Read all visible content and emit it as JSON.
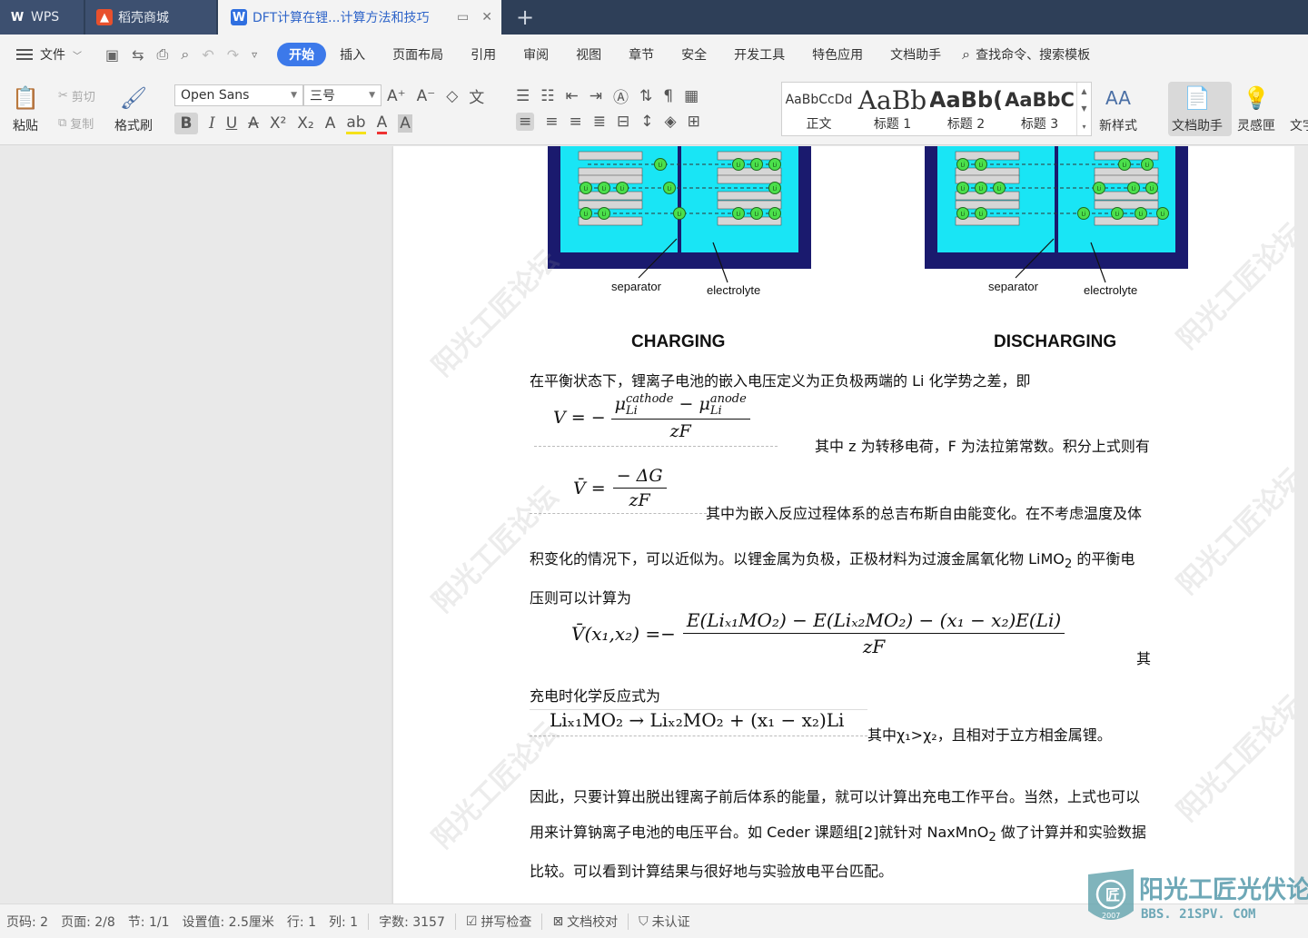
{
  "tabs": [
    {
      "label": "WPS",
      "icon": "wps-logo-icon"
    },
    {
      "label": "稻壳商城",
      "icon": "docer-icon"
    },
    {
      "label": "DFT计算在锂...计算方法和技巧",
      "icon": "word-doc-icon",
      "active": true
    }
  ],
  "menu": {
    "file_label": "文件",
    "tabs": [
      "开始",
      "插入",
      "页面布局",
      "引用",
      "审阅",
      "视图",
      "章节",
      "安全",
      "开发工具",
      "特色应用",
      "文档助手"
    ],
    "active_tab": "开始",
    "search_label": "查找命令、搜索模板"
  },
  "ribbon": {
    "paste": "粘贴",
    "cut": "剪切",
    "copy": "复制",
    "format_painter": "格式刷",
    "font_name": "Open Sans",
    "font_size": "三号",
    "styles": [
      {
        "sample": "AaBbCcDd",
        "label": "正文"
      },
      {
        "sample": "AaBb",
        "label": "标题 1"
      },
      {
        "sample": "AaBb(",
        "label": "标题 2"
      },
      {
        "sample": "AaBbC",
        "label": "标题 3"
      }
    ],
    "new_style": "新样式",
    "doc_assistant": "文档助手",
    "inspiration": "灵感匣",
    "text_tool": "文字"
  },
  "document": {
    "figure_labels": {
      "separator": "separator",
      "electrolyte": "electrolyte",
      "li": "Li"
    },
    "captions": {
      "charging": "CHARGING",
      "discharging": "DISCHARGING"
    },
    "para1": "在平衡状态下，锂离子电池的嵌入电压定义为正负极两端的 Li 化学势之差，即",
    "eq1": {
      "lhs": "V = −",
      "num_a": "μ",
      "num_a_sup": "cathode",
      "num_a_sub": "Li",
      "minus": " − ",
      "num_b": "μ",
      "num_b_sup": "anode",
      "num_b_sub": "Li",
      "den": "zF"
    },
    "para2": "其中 z 为转移电荷，F 为法拉第常数。积分上式则有",
    "eq2": {
      "lhs": "V̄ =",
      "num": "− ΔG",
      "den": "zF"
    },
    "para3a": "其中为嵌入反应过程体系的总吉布斯自由能变化。在不考虑温度及体",
    "para3b_pre": "积变化的情况下，可以近似为。以锂金属为负极，正极材料为过渡金属氧化物 LiMO",
    "para3b_sub": "2",
    "para3b_post": " 的平衡电",
    "para3c": "压则可以计算为",
    "eq3": {
      "lhs": "V̄(x₁,x₂) =−",
      "num": "E(Liₓ₁MO₂) − E(Liₓ₂MO₂) − (x₁ − x₂)E(Li)",
      "den": "zF"
    },
    "para4_tail": "其",
    "para5": "充电时化学反应式为",
    "eq4": "Liₓ₁MO₂ → Liₓ₂MO₂ + (x₁ − x₂)Li",
    "para6": "其中χ₁>χ₂，且相对于立方相金属锂。",
    "para7a": "因此，只要计算出脱出锂离子前后体系的能量，就可以计算出充电工作平台。当然，上式也可以",
    "para7b_pre": "用来计算钠离子电池的电压平台。如 Ceder 课题组[2]就针对 NaxMnO",
    "para7b_sub": "2",
    "para7b_post": " 做了计算并和实验数据",
    "para7c": "比较。可以看到计算结果与很好地与实验放电平台匹配。"
  },
  "watermark": {
    "main": "阳光工匠论坛",
    "sub": "BBS. 21SPV. COM",
    "logo_main": "阳光工匠光伏论坛",
    "logo_sub": "BBS. 21SPV. COM",
    "logo_year": "2007"
  },
  "status": {
    "page_no": "页码: 2",
    "pages": "页面: 2/8",
    "section": "节: 1/1",
    "setting": "设置值: 2.5厘米",
    "row": "行: 1",
    "col": "列: 1",
    "words": "字数: 3157",
    "spell_check": "拼写检查",
    "doc_proof": "文档校对",
    "uncertified": "未认证"
  },
  "colors": {
    "accent": "#3c79ea",
    "tabbar": "#2e3f58",
    "battery_blue": "#1a1a6e",
    "electrolyte": "#19e5f5",
    "li_ion": "#4be04b"
  }
}
